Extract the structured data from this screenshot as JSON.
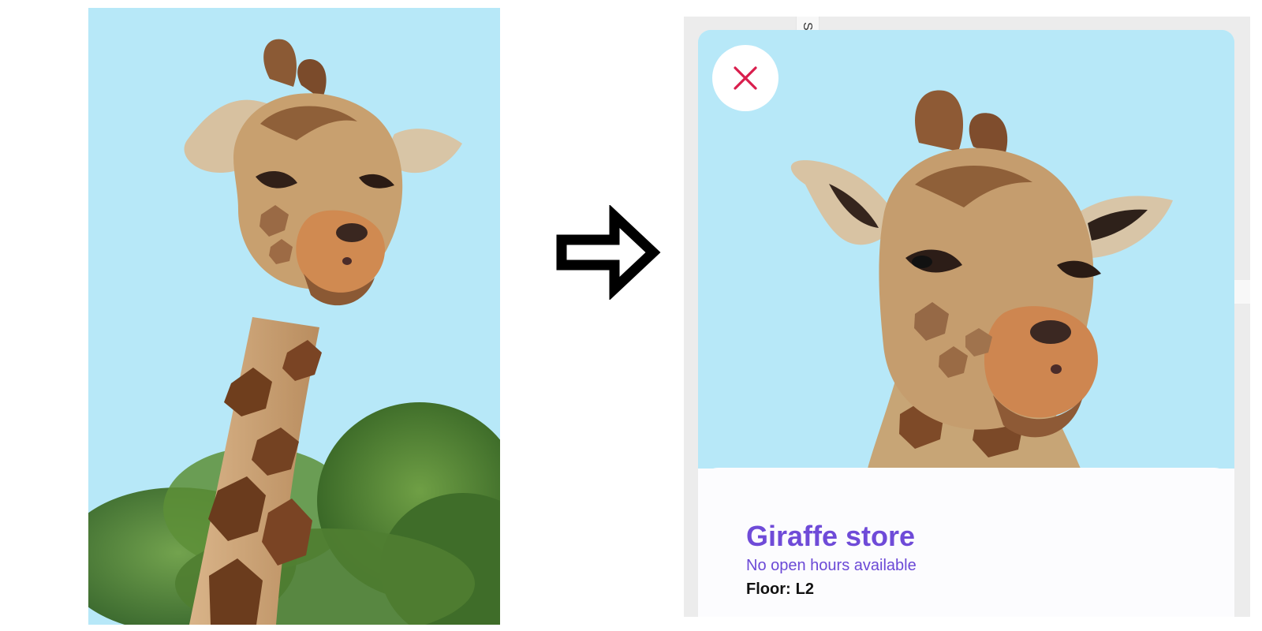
{
  "source_image": {
    "subject": "giraffe"
  },
  "transition": {
    "icon": "arrow-right-icon"
  },
  "app": {
    "side_tab_text": "S",
    "close_icon": "close-icon",
    "store": {
      "title": "Giraffe store",
      "hours": "No open hours available",
      "floor_label": "Floor:",
      "floor_value": "L2"
    }
  },
  "colors": {
    "sky": "#b7e8f8",
    "store_title": "#6f4bd8",
    "hours_text": "#6b49d6",
    "close_x": "#d91e4d",
    "panel_bg": "#fcfcfe"
  }
}
